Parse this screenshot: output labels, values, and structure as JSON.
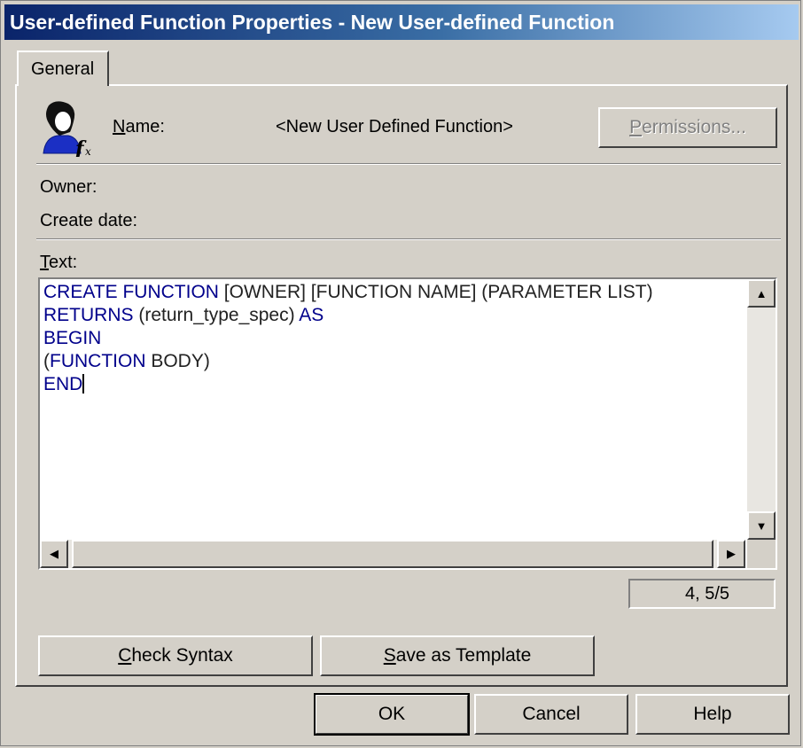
{
  "window": {
    "title": "User-defined Function Properties - New User-defined Function"
  },
  "tabs": [
    {
      "label": "General",
      "selected": true
    }
  ],
  "general": {
    "icon": "user-defined-function-icon",
    "name_label_prefix": "N",
    "name_label_rest": "ame:",
    "name_value": "<New User Defined Function>",
    "permissions_prefix": "P",
    "permissions_rest": "ermissions...",
    "owner_label": "Owner:",
    "create_date_label": "Create date:",
    "text_label_prefix": "T",
    "text_label_rest": "ext:"
  },
  "editor": {
    "lines": [
      [
        {
          "t": "CREATE FUNCTION",
          "k": true
        },
        {
          "t": " [OWNER] [FUNCTION NAME] (PARAMETER LIST)",
          "k": false
        }
      ],
      [
        {
          "t": "RETURNS",
          "k": true
        },
        {
          "t": " (return_type_spec) ",
          "k": false
        },
        {
          "t": "AS",
          "k": true
        }
      ],
      [
        {
          "t": "BEGIN",
          "k": true
        }
      ],
      [
        {
          "t": "(",
          "k": false
        },
        {
          "t": "FUNCTION",
          "k": true
        },
        {
          "t": " BODY)",
          "k": false
        }
      ],
      [
        {
          "t": "END",
          "k": true
        }
      ]
    ],
    "cursor_position": "4, 5/5"
  },
  "actions": {
    "check_syntax_prefix": "C",
    "check_syntax_rest": "heck Syntax",
    "save_template_prefix": "S",
    "save_template_rest": "ave as Template"
  },
  "dialog_buttons": {
    "ok": "OK",
    "cancel": "Cancel",
    "help": "Help"
  },
  "colors": {
    "titlebar_start": "#0a246a",
    "titlebar_end": "#a6caf0",
    "keyword": "#00008b",
    "dialog_face": "#d4d0c8"
  }
}
